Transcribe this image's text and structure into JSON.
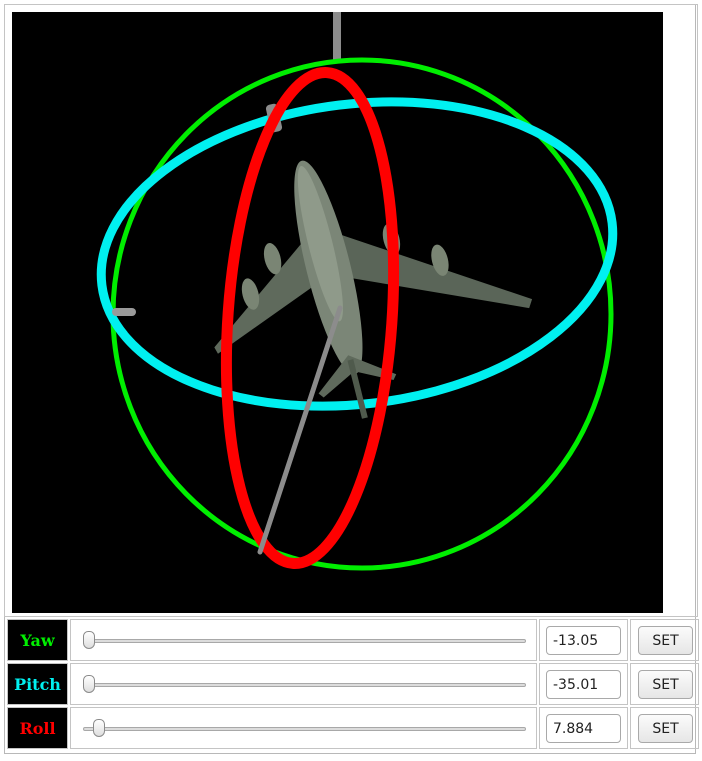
{
  "scene": {
    "ring_colors": {
      "yaw": "#00ee00",
      "pitch": "#00f0f0",
      "roll": "#ff0000"
    },
    "axis_color": "#8c8c8c",
    "background": "#000000"
  },
  "controls": [
    {
      "key": "yaw",
      "label": "Yaw",
      "color": "#00ee00",
      "value": "-13.05",
      "button": "SET",
      "level": 0.0
    },
    {
      "key": "pitch",
      "label": "Pitch",
      "color": "#00f0f0",
      "value": "-35.01",
      "button": "SET",
      "level": 0.0
    },
    {
      "key": "roll",
      "label": "Roll",
      "color": "#ff0000",
      "value": "7.884",
      "button": "SET",
      "level": 0.022
    }
  ]
}
